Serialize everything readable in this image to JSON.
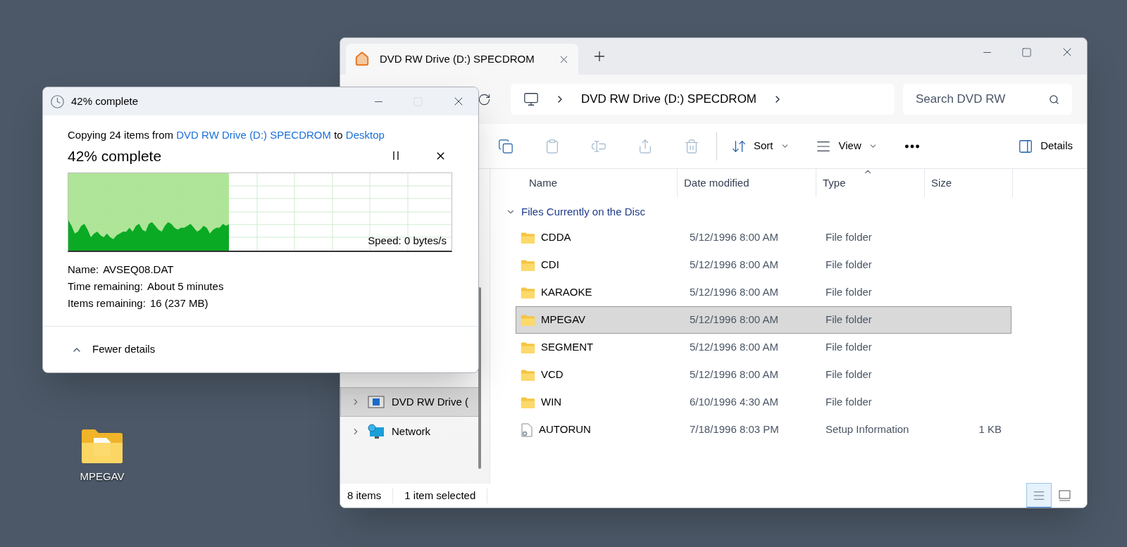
{
  "desktop": {
    "icons": [
      {
        "label": "MPEGAV",
        "kind": "folder"
      }
    ]
  },
  "explorer": {
    "tabs": [
      {
        "title": "DVD RW Drive (D:) SPECDROM",
        "selected": true
      }
    ],
    "address": {
      "breadcrumbs": [
        "DVD RW Drive (D:) SPECDROM"
      ]
    },
    "search": {
      "placeholder": "Search DVD RW"
    },
    "toolbar": {
      "actions": [
        {
          "kind": "copy",
          "disabled": false
        },
        {
          "kind": "paste",
          "disabled": true
        },
        {
          "kind": "rename",
          "disabled": true
        },
        {
          "kind": "share",
          "disabled": true
        },
        {
          "kind": "delete",
          "disabled": true
        }
      ],
      "sort": "Sort",
      "view": "View",
      "details": "Details"
    },
    "nav_pane": {
      "items": [
        {
          "label": "DVD RW Drive (",
          "kind": "drive",
          "selected": true
        },
        {
          "label": "Network",
          "kind": "network",
          "selected": false
        }
      ]
    },
    "file_list": {
      "columns": [
        {
          "label": "Name",
          "sorted": false
        },
        {
          "label": "Date modified",
          "sorted": false
        },
        {
          "label": "Type",
          "sorted": true
        },
        {
          "label": "Size",
          "sorted": false
        }
      ],
      "group": {
        "label": "Files Currently on the Disc",
        "expanded": true
      },
      "rows": [
        {
          "name": "CDDA",
          "date": "5/12/1996 8:00 AM",
          "type": "File folder",
          "kind": "folder",
          "selected": false
        },
        {
          "name": "CDI",
          "date": "5/12/1996 8:00 AM",
          "type": "File folder",
          "kind": "folder",
          "selected": false
        },
        {
          "name": "KARAOKE",
          "date": "5/12/1996 8:00 AM",
          "type": "File folder",
          "kind": "folder",
          "selected": false
        },
        {
          "name": "MPEGAV",
          "date": "5/12/1996 8:00 AM",
          "type": "File folder",
          "kind": "folder",
          "selected": true
        },
        {
          "name": "SEGMENT",
          "date": "5/12/1996 8:00 AM",
          "type": "File folder",
          "kind": "folder",
          "selected": false
        },
        {
          "name": "VCD",
          "date": "5/12/1996 8:00 AM",
          "type": "File folder",
          "kind": "folder",
          "selected": false
        },
        {
          "name": "WIN",
          "date": "6/10/1996 4:30 AM",
          "type": "File folder",
          "kind": "folder",
          "selected": false
        },
        {
          "name": "AUTORUN",
          "date": "7/18/1996 8:03 PM",
          "type": "Setup Information",
          "size": "1 KB",
          "kind": "file",
          "selected": false
        }
      ]
    },
    "status_bar": {
      "item_count": "8 items",
      "selection": "1 item selected",
      "view_modes": [
        {
          "kind": "details",
          "selected": true
        },
        {
          "kind": "tiles",
          "selected": false
        }
      ]
    }
  },
  "copy_dialog": {
    "title": "42% complete",
    "summary": {
      "prefix": "Copying 24 items from",
      "source": "DVD RW Drive (D:) SPECDROM",
      "joiner": "to",
      "destination": "Desktop"
    },
    "heading": "42% complete",
    "progress": {
      "level": 0.42,
      "speed": "Speed: 0 bytes/s"
    },
    "details": [
      {
        "label": "Name:",
        "value": "AVSEQ08.DAT"
      },
      {
        "label": "Time remaining:",
        "value": "About 5 minutes"
      },
      {
        "label": "Items remaining:",
        "value": "16 (237 MB)"
      }
    ],
    "toggle": {
      "label": "Fewer details",
      "expanded": true
    }
  }
}
